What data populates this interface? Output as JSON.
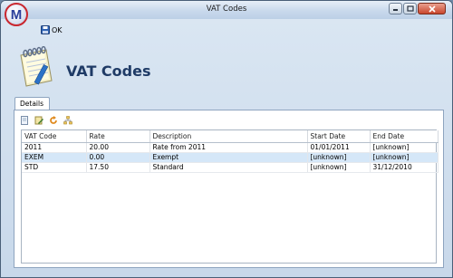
{
  "window": {
    "title": "VAT Codes"
  },
  "app_logo": {
    "letter": "M"
  },
  "toolbar": {
    "ok_label": "OK"
  },
  "header": {
    "title": "VAT Codes"
  },
  "tabs": [
    {
      "label": "Details"
    }
  ],
  "grid": {
    "columns": [
      "VAT Code",
      "Rate",
      "Description",
      "Start Date",
      "End Date"
    ],
    "rows": [
      {
        "code": "2011",
        "rate": "20.00",
        "description": "Rate from 2011",
        "start": "01/01/2011",
        "end": "[unknown]"
      },
      {
        "code": "EXEM",
        "rate": "0.00",
        "description": "Exempt",
        "start": "[unknown]",
        "end": "[unknown]"
      },
      {
        "code": "STD",
        "rate": "17.50",
        "description": "Standard",
        "start": "[unknown]",
        "end": "31/12/2010"
      }
    ],
    "selected_row": 1
  },
  "colors": {
    "title_color": "#1f3b66",
    "selected_row": "#d5e7f8"
  }
}
